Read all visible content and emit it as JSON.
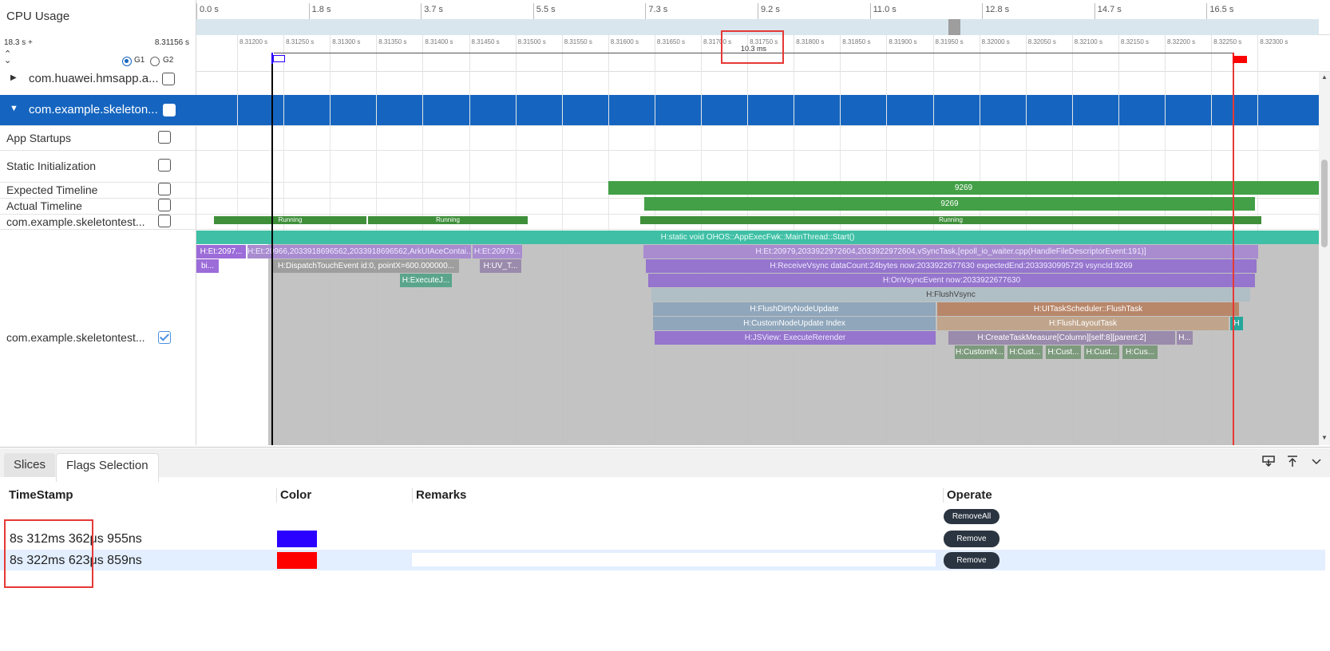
{
  "header": {
    "cpu_usage_label": "CPU Usage",
    "total_ticks": [
      "0.0 s",
      "1.8 s",
      "3.7 s",
      "5.5 s",
      "7.3 s",
      "9.2 s",
      "11.0 s",
      "12.8 s",
      "14.7 s",
      "16.5 s"
    ],
    "duration_label": "18.3 s +",
    "range_start": "8.31156 s",
    "g1_label": "G1",
    "g2_label": "G2",
    "zoom_ticks": [
      "8.31200 s",
      "8.31250 s",
      "8.31300 s",
      "8.31350 s",
      "8.31400 s",
      "8.31450 s",
      "8.31500 s",
      "8.31550 s",
      "8.31600 s",
      "8.31650 s",
      "8.31700 s",
      "8.31750 s",
      "8.31800 s",
      "8.31850 s",
      "8.31900 s",
      "8.31950 s",
      "8.32000 s",
      "8.32050 s",
      "8.32100 s",
      "8.32150 s",
      "8.32200 s",
      "8.32250 s",
      "8.32300 s"
    ],
    "flag_interval": "10.3 ms"
  },
  "tracks": {
    "process_collapsed": "com.huawei.hmsapp.a...",
    "process_expanded": "com.example.skeleton...",
    "app_startups": "App Startups",
    "static_init": "Static Initialization",
    "expected_timeline": "Expected Timeline",
    "actual_timeline": "Actual Timeline",
    "thread_state": "com.example.skeletontest...",
    "thread_slices": "com.example.skeletontest..."
  },
  "timeline": {
    "expected_frame": "9269",
    "actual_frame": "9269",
    "running": [
      "Running",
      "Running",
      "Running"
    ],
    "slices": {
      "main_thread": "H:static void OHOS::AppExecFwk::MainThread::Start()",
      "et_a": "H:Et:2097...",
      "et_b": "H:Et:20966,2033918696562,2033918696562,ArkUIAceContai...",
      "et_c": "H:Et:20979...",
      "et_d": "H:Et:20979,2033922972604,2033922972604,vSyncTask,[epoll_io_waiter.cpp(HandleFileDescriptorEvent:191)]",
      "bi": "bi...",
      "dispatch": "H:DispatchTouchEvent id:0, pointX=600.000000...",
      "uv": "H:UV_T...",
      "receive_vsync": "H:ReceiveVsync dataCount:24bytes now:2033922677630 expectedEnd:2033930995729 vsyncId:9269",
      "execute_j": "H:ExecuteJ...",
      "on_vsync": "H:OnVsyncEvent now:2033922677630",
      "flush_vsync": "H:FlushVsync",
      "flush_dirty": "H:FlushDirtyNodeUpdate",
      "ui_task": "H:UITaskScheduler::FlushTask",
      "custom_node": "H:CustomNodeUpdate Index",
      "flush_layout": "H:FlushLayoutTask",
      "h_small": "H",
      "jsview": "H:JSView: ExecuteRerender",
      "create_task": "H:CreateTaskMeasure[Column][self:8][parent:2]",
      "h_dots": "H...",
      "custom_n": "H:CustomN...",
      "cust1": "H:Cust...",
      "cust2": "H:Cust...",
      "cust3": "H:Cust...",
      "cus4": "H:Cus..."
    }
  },
  "bottom": {
    "tabs": [
      "Slices",
      "Flags Selection"
    ],
    "columns": {
      "timestamp": "TimeStamp",
      "color": "Color",
      "remarks": "Remarks",
      "operate": "Operate"
    },
    "remove_all": "RemoveAll",
    "remove": "Remove",
    "rows": [
      {
        "timestamp": "8s 312ms 362μs 955ns",
        "color": "#2a00ff",
        "remarks": ""
      },
      {
        "timestamp": "8s 322ms 623μs 859ns",
        "color": "#ff0000",
        "remarks": ""
      }
    ]
  },
  "colors": {
    "accent": "#1565c0",
    "green": "#43a047",
    "running": "#3f8f3a",
    "purple": "#9575cd",
    "teal": "#26a69a"
  }
}
